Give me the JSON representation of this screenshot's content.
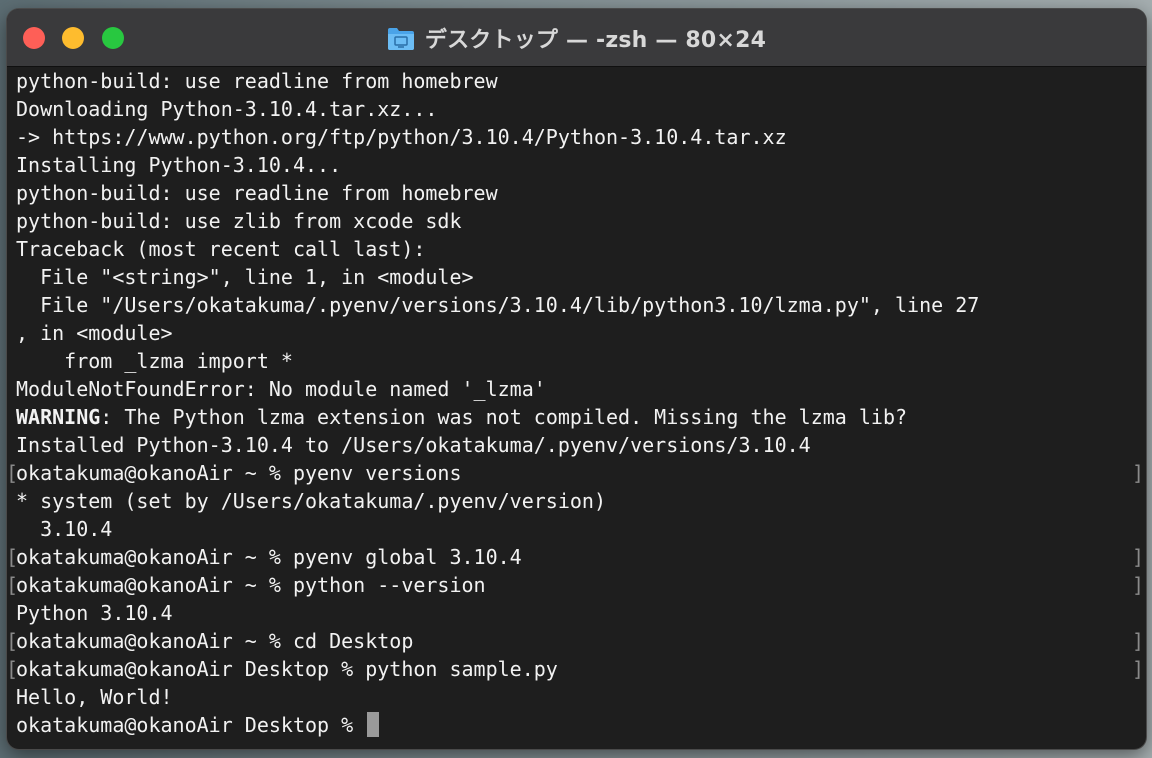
{
  "window": {
    "title": "デスクトップ — -zsh — 80×24"
  },
  "terminal": {
    "lines": [
      {
        "text": "python-build: use readline from homebrew"
      },
      {
        "text": "Downloading Python-3.10.4.tar.xz..."
      },
      {
        "text": "-> https://www.python.org/ftp/python/3.10.4/Python-3.10.4.tar.xz"
      },
      {
        "text": "Installing Python-3.10.4..."
      },
      {
        "text": "python-build: use readline from homebrew"
      },
      {
        "text": "python-build: use zlib from xcode sdk"
      },
      {
        "text": "Traceback (most recent call last):"
      },
      {
        "text": "  File \"<string>\", line 1, in <module>"
      },
      {
        "text": "  File \"/Users/okatakuma/.pyenv/versions/3.10.4/lib/python3.10/lzma.py\", line 27"
      },
      {
        "text": ", in <module>"
      },
      {
        "text": "    from _lzma import *"
      },
      {
        "text": "ModuleNotFoundError: No module named '_lzma'"
      },
      {
        "bold": "WARNING",
        "text": ": The Python lzma extension was not compiled. Missing the lzma lib?"
      },
      {
        "text": "Installed Python-3.10.4 to /Users/okatakuma/.pyenv/versions/3.10.4"
      },
      {
        "text": "okatakuma@okanoAir ~ % pyenv versions",
        "marked": true
      },
      {
        "text": "* system (set by /Users/okatakuma/.pyenv/version)"
      },
      {
        "text": "  3.10.4"
      },
      {
        "text": "okatakuma@okanoAir ~ % pyenv global 3.10.4",
        "marked": true
      },
      {
        "text": "okatakuma@okanoAir ~ % python --version",
        "marked": true
      },
      {
        "text": "Python 3.10.4"
      },
      {
        "text": "okatakuma@okanoAir ~ % cd Desktop",
        "marked": true
      },
      {
        "text": "okatakuma@okanoAir Desktop % python sample.py",
        "marked": true
      },
      {
        "text": "Hello, World!"
      },
      {
        "text": "okatakuma@okanoAir Desktop % ",
        "cursor": true
      }
    ]
  },
  "colors": {
    "close": "#fe5f57",
    "minimize": "#febc2e",
    "maximize": "#28c840",
    "background": "#1e1e1e",
    "text": "#f2f2f2"
  },
  "icons": {
    "title_icon": "folder-icon"
  }
}
